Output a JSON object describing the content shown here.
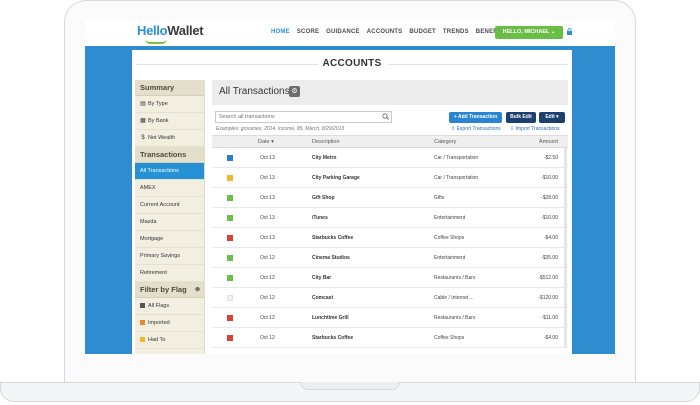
{
  "brand": {
    "logo_hello": "Hello",
    "logo_wallet": "Wallet"
  },
  "nav": {
    "items": [
      {
        "label": "HOME",
        "active": true
      },
      {
        "label": "SCORE",
        "active": false
      },
      {
        "label": "GUIDANCE",
        "active": false
      },
      {
        "label": "ACCOUNTS",
        "active": false
      },
      {
        "label": "BUDGET",
        "active": false
      },
      {
        "label": "TRENDS",
        "active": false
      },
      {
        "label": "BENEFITS",
        "active": false
      }
    ],
    "user_button": "HELLO, MICHAEL ⌄"
  },
  "page": {
    "title": "ACCOUNTS"
  },
  "sidebar": {
    "summary_head": "Summary",
    "summary_items": [
      {
        "label": "By Type",
        "icon": "list-icon",
        "glyph": "▤"
      },
      {
        "label": "By Bank",
        "icon": "bank-icon",
        "glyph": "▦"
      },
      {
        "label": "Net Wealth",
        "icon": "dollar-icon",
        "glyph": "$"
      }
    ],
    "transactions_head": "Transactions",
    "transaction_items": [
      {
        "label": "All Transactions",
        "active": true
      },
      {
        "label": "AMEX",
        "active": false
      },
      {
        "label": "Current Account",
        "active": false
      },
      {
        "label": "Mazda",
        "active": false
      },
      {
        "label": "Mortgage",
        "active": false
      },
      {
        "label": "Primary Savings",
        "active": false
      },
      {
        "label": "Retirement",
        "active": false
      }
    ],
    "flag_head": "Filter by Flag",
    "flag_items": [
      {
        "label": "All Flags",
        "color": "#555555"
      },
      {
        "label": "Imported",
        "color": "#e38a2b"
      },
      {
        "label": "Had To",
        "color": "#f1b82d"
      }
    ]
  },
  "main": {
    "title": "All Transactions",
    "search_placeholder": "Search all transactions",
    "examples": "Examples: groceries, 2014, income, 85, March, 8/29/2013",
    "add_button": "+ Add Transaction",
    "bulk_button": "Bulk Edit",
    "edit_button": "Edit ▾",
    "export_link": "Export Transactions",
    "import_link": "Import Transactions",
    "columns": {
      "date": "Date ▾",
      "description": "Description",
      "category": "Category",
      "amount": "Amount"
    },
    "rows": [
      {
        "flag": "#2a7fd0",
        "date": "Oct 13",
        "description": "City Metro",
        "category": "Car / Transportation",
        "amount": "-$2.50"
      },
      {
        "flag": "#f1b82d",
        "date": "Oct 13",
        "description": "City Parking Garage",
        "category": "Car / Transportation",
        "amount": "-$10.00"
      },
      {
        "flag": "#6abd45",
        "date": "Oct 13",
        "description": "Gift Shop",
        "category": "Gifts",
        "amount": "-$28.00"
      },
      {
        "flag": "#6abd45",
        "date": "Oct 13",
        "description": "iTunes",
        "category": "Entertainment",
        "amount": "-$10.00"
      },
      {
        "flag": "#d9423a",
        "date": "Oct 13",
        "description": "Starbucks Coffee",
        "category": "Coffee Shops",
        "amount": "-$4.00"
      },
      {
        "flag": "#6abd45",
        "date": "Oct 12",
        "description": "Cinema Studios",
        "category": "Entertainment",
        "amount": "-$35.00"
      },
      {
        "flag": "#6abd45",
        "date": "Oct 12",
        "description": "City Bar",
        "category": "Restaurants / Bars",
        "amount": "-$512.00"
      },
      {
        "flag": "#f2f2f2",
        "date": "Oct 12",
        "description": "Comcast",
        "category": "Cable / Internet ...",
        "amount": "-$120.00"
      },
      {
        "flag": "#d9423a",
        "date": "Oct 12",
        "description": "Lunchtime Grill",
        "category": "Restaurants / Bars",
        "amount": "-$11.00"
      },
      {
        "flag": "#d9423a",
        "date": "Oct 12",
        "description": "Starbucks Coffee",
        "category": "Coffee Shops",
        "amount": "-$4.00"
      }
    ]
  }
}
